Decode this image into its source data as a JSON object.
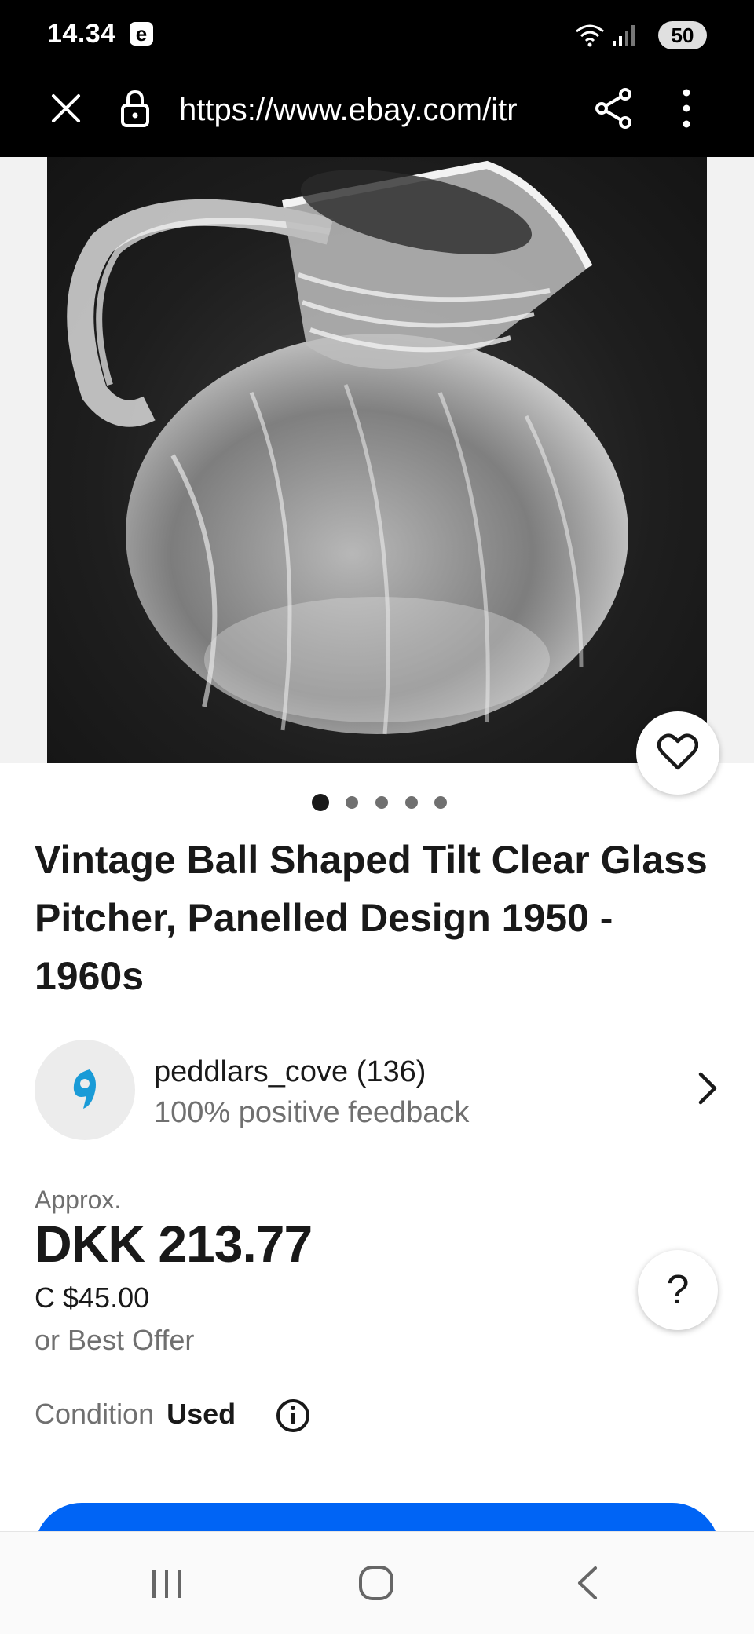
{
  "status_bar": {
    "time": "14.34",
    "app_badge": "e",
    "battery": "50"
  },
  "browser": {
    "url": "https://www.ebay.com/itr",
    "icons": [
      "close-icon",
      "lock-icon",
      "share-icon",
      "more-vert-icon"
    ]
  },
  "carousel": {
    "image_count": 5,
    "active_index": 0,
    "image_description_icon": "glass-pitcher-photo"
  },
  "product": {
    "title": "Vintage Ball Shaped Tilt Clear Glass Pitcher, Panelled Design 1950 - 1960s"
  },
  "seller": {
    "name": "peddlars_cove (136)",
    "feedback": "100% positive feedback"
  },
  "price": {
    "approx_label": "Approx.",
    "main": "DKK 213.77",
    "original": "C $45.00",
    "offer": "or Best Offer"
  },
  "condition": {
    "label": "Condition",
    "value": "Used"
  },
  "help": {
    "label": "?"
  },
  "colors": {
    "accent_blue": "#0064f5",
    "text_primary": "#191919",
    "text_secondary": "#707070",
    "seller_logo": "#1a9bd7"
  }
}
